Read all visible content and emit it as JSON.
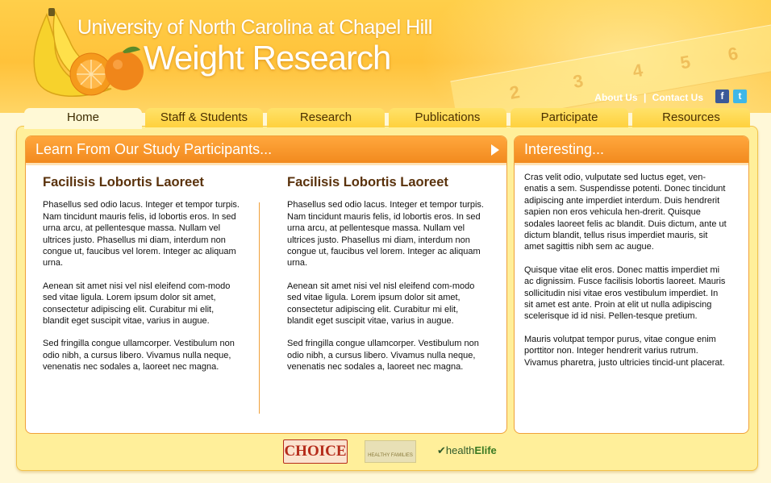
{
  "header": {
    "university": "University of North Carolina at Chapel Hill",
    "site_name": "Weight Research",
    "links": {
      "about": "About Us",
      "separator": "|",
      "contact": "Contact Us"
    },
    "social": {
      "facebook": "f",
      "twitter": "t"
    },
    "tape_numbers": [
      "2",
      "3",
      "4",
      "5",
      "6"
    ]
  },
  "nav": {
    "tabs": [
      {
        "label": "Home",
        "active": true
      },
      {
        "label": "Staff & Students",
        "active": false
      },
      {
        "label": "Research",
        "active": false
      },
      {
        "label": "Publications",
        "active": false
      },
      {
        "label": "Participate",
        "active": false
      },
      {
        "label": "Resources",
        "active": false
      }
    ]
  },
  "main_panel": {
    "title": "Learn From Our Study Participants...",
    "columns": [
      {
        "heading": "Facilisis Lobortis Laoreet",
        "paragraphs": [
          "Phasellus sed odio lacus. Integer et tempor turpis. Nam tincidunt mauris felis, id lobortis eros. In sed urna arcu, at pellentesque massa. Nullam vel ultrices justo. Phasellus mi diam, interdum non congue ut, faucibus vel lorem. Integer ac aliquam urna.",
          "Aenean sit amet nisi vel nisl eleifend com-modo sed vitae ligula. Lorem ipsum dolor sit amet, consectetur adipiscing elit. Curabitur mi elit, blandit eget suscipit vitae, varius in augue.",
          "Sed fringilla congue ullamcorper. Vestibulum non odio nibh, a cursus libero. Vivamus nulla neque, venenatis nec sodales a, laoreet nec magna."
        ]
      },
      {
        "heading": "Facilisis Lobortis Laoreet",
        "paragraphs": [
          "Phasellus sed odio lacus. Integer et tempor turpis. Nam tincidunt mauris felis, id lobortis eros. In sed urna arcu, at pellentesque massa. Nullam vel ultrices justo. Phasellus mi diam, interdum non congue ut, faucibus vel lorem. Integer ac aliquam urna.",
          "Aenean sit amet nisi vel nisl eleifend com-modo sed vitae ligula. Lorem ipsum dolor sit amet, consectetur adipiscing elit. Curabitur mi elit, blandit eget suscipit vitae, varius in augue.",
          "Sed fringilla congue ullamcorper. Vestibulum non odio nibh, a cursus libero. Vivamus nulla neque, venenatis nec sodales a, laoreet nec magna."
        ]
      }
    ]
  },
  "side_panel": {
    "title": "Interesting...",
    "paragraphs": [
      "Cras velit odio, vulputate sed luctus eget, ven-enatis a sem. Suspendisse potenti. Donec tincidunt adipiscing ante imperdiet interdum. Duis hendrerit sapien non eros vehicula hen-drerit. Quisque sodales laoreet felis ac blandit. Duis dictum, ante ut dictum blandit, tellus risus imperdiet mauris, sit amet sagittis nibh sem ac augue.",
      "Quisque vitae elit eros. Donec mattis imperdiet mi ac dignissim. Fusce facilisis lobortis laoreet. Mauris sollicitudin nisi vitae eros vestibulum imperdiet. In sit amet est ante. Proin at elit ut nulla adipiscing scelerisque id id nisi. Pellen-tesque pretium.",
      "Mauris volutpat tempor purus, vitae congue enim porttitor non. Integer hendrerit varius rutrum. Vivamus pharetra, justo ultricies tincid-unt placerat."
    ]
  },
  "footer": {
    "logos": [
      {
        "name": "CHOICE"
      },
      {
        "name": "HEALTHY FAMILIES"
      },
      {
        "name": "healthElife",
        "prefix": "health",
        "suffix": "Elife"
      }
    ]
  },
  "colors": {
    "header_yellow": "#ffc23a",
    "panel_orange": "#f28a1e",
    "heading_brown": "#5a320c",
    "tab_yellow": "#ffd13d"
  }
}
